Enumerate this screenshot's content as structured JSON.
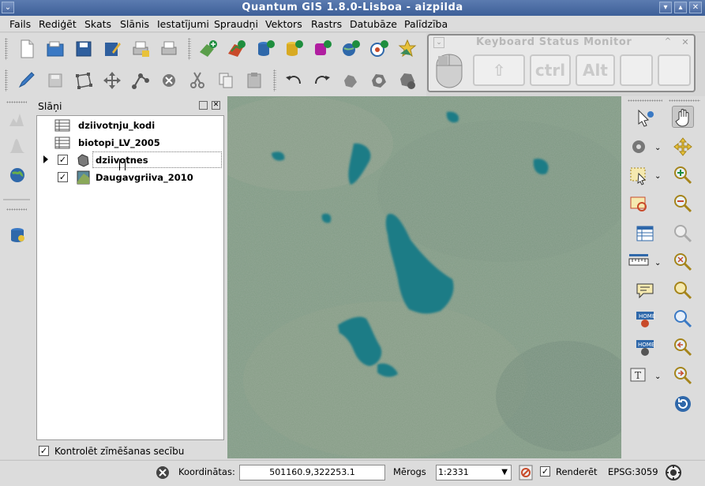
{
  "window": {
    "title": "Quantum GIS 1.8.0-Lisboa - aizpilda",
    "icons": [
      "app-menu-icon",
      "minimize-icon",
      "maximize-icon",
      "close-icon"
    ]
  },
  "menu": {
    "items": [
      "Fails",
      "Rediģēt",
      "Skats",
      "Slānis",
      "Iestatījumi",
      "Spraudņi",
      "Vektors",
      "Rastrs",
      "Datubāze",
      "Palīdzība"
    ]
  },
  "keyboard_monitor": {
    "title": "Keyboard Status Monitor",
    "keys": [
      "ctrl",
      "Alt"
    ],
    "icons": [
      "mouse-icon",
      "shift-arrow-icon"
    ]
  },
  "layers_panel": {
    "title": "Slāņi",
    "layers": [
      {
        "name": "dziivotnju_kodi",
        "checked": false,
        "icon": "table-icon"
      },
      {
        "name": "biotopi_LV_2005",
        "checked": false,
        "icon": "table-icon"
      },
      {
        "name": "dziivotnes",
        "checked": true,
        "icon": "polygon-layer-icon",
        "expandable": true
      },
      {
        "name": "Daugavgriiva_2010",
        "checked": true,
        "icon": "raster-layer-icon"
      }
    ],
    "check_order_label": "Kontrolēt zīmēšanas secību",
    "check_order_checked": true
  },
  "status": {
    "coordinates_label": "Koordinātas:",
    "coordinates_value": "501160.9,322253.1",
    "scale_label": "Mērogs",
    "scale_value": "1:2331",
    "render_label": "Renderēt",
    "render_checked": true,
    "crs": "EPSG:3059"
  },
  "colors": {
    "titlebar": "#3d5f98",
    "map_background": "#7f9a82",
    "water": "#1a7a85"
  }
}
